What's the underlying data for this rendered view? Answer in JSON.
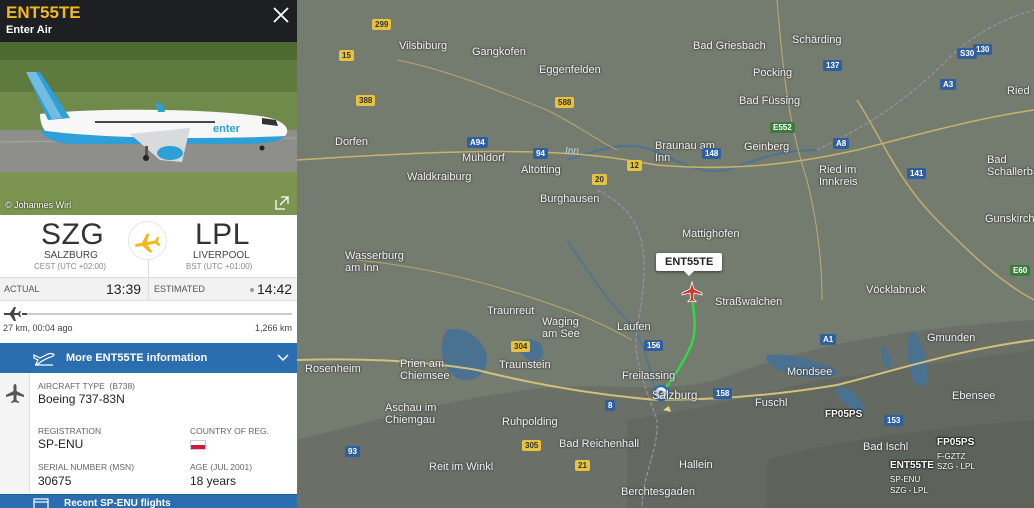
{
  "flight": {
    "id": "ENT55TE",
    "airline": "Enter Air",
    "photo_credit": "© Johannes Wirl",
    "aircraft_livery_text": "enter"
  },
  "route": {
    "origin": {
      "iata": "SZG",
      "city": "SALZBURG",
      "tz": "CEST (UTC +02:00)"
    },
    "destination": {
      "iata": "LPL",
      "city": "LIVERPOOL",
      "tz": "BST (UTC +01:00)"
    }
  },
  "times": {
    "actual_label": "ACTUAL",
    "actual_value": "13:39",
    "estimated_label": "ESTIMATED",
    "estimated_value": "14:42"
  },
  "progress": {
    "flown": "27 km, 00:04 ago",
    "remaining": "1,266 km",
    "fraction": 0.02
  },
  "more_info_label": "More ENT55TE information",
  "details": {
    "aircraft_type_label": "AIRCRAFT TYPE",
    "aircraft_type_code": "(B738)",
    "aircraft_type_value": "Boeing 737-83N",
    "registration_label": "REGISTRATION",
    "registration_value": "SP-ENU",
    "country_label": "COUNTRY OF REG.",
    "serial_label": "SERIAL NUMBER (MSN)",
    "serial_value": "30675",
    "age_label": "AGE (JUL 2001)",
    "age_value": "18 years"
  },
  "bottom_bar_label": "Recent SP-ENU flights",
  "colors": {
    "accent_yellow": "#f5b81a",
    "header_dark": "#1d1f22",
    "button_blue": "#2a6eb0",
    "track_green": "#32d84a",
    "aircraft_red": "#d0342c"
  },
  "map": {
    "flight_tag": "ENT55TE",
    "towns": [
      {
        "name": "Vilsbiburg"
      },
      {
        "name": "Gangkofen"
      },
      {
        "name": "Bad Griesbach"
      },
      {
        "name": "Schärding"
      },
      {
        "name": "Eggenfelden"
      },
      {
        "name": "Pocking"
      },
      {
        "name": "Bad Füssing"
      },
      {
        "name": "Ried"
      },
      {
        "name": "Dorfen"
      },
      {
        "name": "Mühldorf"
      },
      {
        "name": "Braunau am Inn"
      },
      {
        "name": "Geinberg"
      },
      {
        "name": "Waldkraiburg"
      },
      {
        "name": "Altötting"
      },
      {
        "name": "Ried im Innkreis"
      },
      {
        "name": "Bad Schallerbach"
      },
      {
        "name": "Burghausen"
      },
      {
        "name": "Gunskirchen"
      },
      {
        "name": "Wasserburg am Inn"
      },
      {
        "name": "Mattighofen"
      },
      {
        "name": "Straßwalchen"
      },
      {
        "name": "Vöcklabruck"
      },
      {
        "name": "Traunreut"
      },
      {
        "name": "Laufen"
      },
      {
        "name": "Waging am See"
      },
      {
        "name": "Rosenheim"
      },
      {
        "name": "Prien am Chiemsee"
      },
      {
        "name": "Traunstein"
      },
      {
        "name": "Gmunden"
      },
      {
        "name": "Freilassing"
      },
      {
        "name": "Salzburg"
      },
      {
        "name": "Mondsee"
      },
      {
        "name": "Aschau im Chiemgau"
      },
      {
        "name": "Ruhpolding"
      },
      {
        "name": "Fuschl"
      },
      {
        "name": "Ebensee"
      },
      {
        "name": "Bad Reichenhall"
      },
      {
        "name": "Hallein"
      },
      {
        "name": "Reit im Winkl"
      },
      {
        "name": "Bad Ischl"
      },
      {
        "name": "Berchtesgaden"
      }
    ],
    "road_shields": [
      {
        "label": "299",
        "style": "y"
      },
      {
        "label": "15",
        "style": "y"
      },
      {
        "label": "388",
        "style": "y"
      },
      {
        "label": "588",
        "style": "y"
      },
      {
        "label": "137",
        "style": "b"
      },
      {
        "label": "A3",
        "style": "b"
      },
      {
        "label": "A8",
        "style": "b"
      },
      {
        "label": "E552",
        "style": "g"
      },
      {
        "label": "148",
        "style": "b"
      },
      {
        "label": "A94",
        "style": "b"
      },
      {
        "label": "94",
        "style": "b"
      },
      {
        "label": "12",
        "style": "y"
      },
      {
        "label": "20",
        "style": "y"
      },
      {
        "label": "141",
        "style": "b"
      },
      {
        "label": "E60",
        "style": "g"
      },
      {
        "label": "156",
        "style": "b"
      },
      {
        "label": "304",
        "style": "y"
      },
      {
        "label": "A1",
        "style": "b"
      },
      {
        "label": "158",
        "style": "b"
      },
      {
        "label": "153",
        "style": "b"
      },
      {
        "label": "305",
        "style": "y"
      },
      {
        "label": "21",
        "style": "y"
      },
      {
        "label": "93",
        "style": "b"
      },
      {
        "label": "8",
        "style": "b"
      },
      {
        "label": "130",
        "style": "b"
      },
      {
        "label": "S30",
        "style": "b"
      }
    ],
    "river_name": "Inn",
    "other_aircraft": [
      {
        "callsign": "FP05PS",
        "details": []
      },
      {
        "callsign": "FP05PS",
        "details": [
          "F-GZTZ",
          "SZG - LPL"
        ]
      },
      {
        "callsign": "ENT55TE",
        "details": [
          "SP-ENU",
          "SZG - LPL"
        ]
      }
    ]
  }
}
